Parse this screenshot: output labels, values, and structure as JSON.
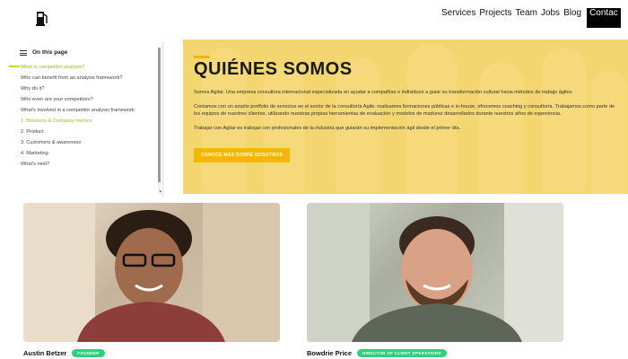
{
  "nav": {
    "logo_icon": "fuel-pump-icon",
    "items": [
      "Services",
      "Projects",
      "Team",
      "Jobs",
      "Blog"
    ],
    "contact_label": "Contac"
  },
  "toc": {
    "title": "On this page",
    "items": [
      {
        "label": "What is competitor analysis?",
        "active": true
      },
      {
        "label": "Who can benefit from an analysis framework?",
        "active": false
      },
      {
        "label": "Why do it?",
        "active": false
      },
      {
        "label": "Who even are your competitors?",
        "active": false
      },
      {
        "label": "What's involved in a competitor analysis framework",
        "active": false
      },
      {
        "label": "1. Business & Company metrics",
        "active": true
      },
      {
        "label": "2. Product",
        "active": false
      },
      {
        "label": "3. Customers & awareness",
        "active": false
      },
      {
        "label": "4. Marketing",
        "active": false
      },
      {
        "label": "What's next?",
        "active": false
      }
    ]
  },
  "hero": {
    "title": "QUIÉNES SOMOS",
    "paragraphs": [
      "Somos Agilar. Una empresa consultora internacional especializada en ayudar a compañías e individuos a guiar su transformación cultural hacia métodos de trabajo ágiles.",
      "Contamos con un amplio portfolio de servicios en el sector de la consultoría Agile: realizamos formaciones públicas e in-house, ofrecemos coaching y consultoría. Trabajamos como parte de los equipos de nuestros clientes, utilizando nuestras propias herramientas de evaluación y modelos de madurez desarrollados durante nuestros años de experiencia.",
      "Trabajar con Agilar es trabajar con profesionales de la industria que guiarán su implementación ágil desde el primer día."
    ],
    "button_label": "CONOCE MÁS SOBRE NOSOTROS"
  },
  "team": [
    {
      "name": "Austin Betzer",
      "role": "FOUNDER"
    },
    {
      "name": "Bowdrie Price",
      "role": "DIRECTOR OF CLIENT OPERATIONS"
    }
  ],
  "colors": {
    "accent": "#f2b705",
    "badge": "#2ed07a",
    "toc_active": "#8fc21f"
  }
}
